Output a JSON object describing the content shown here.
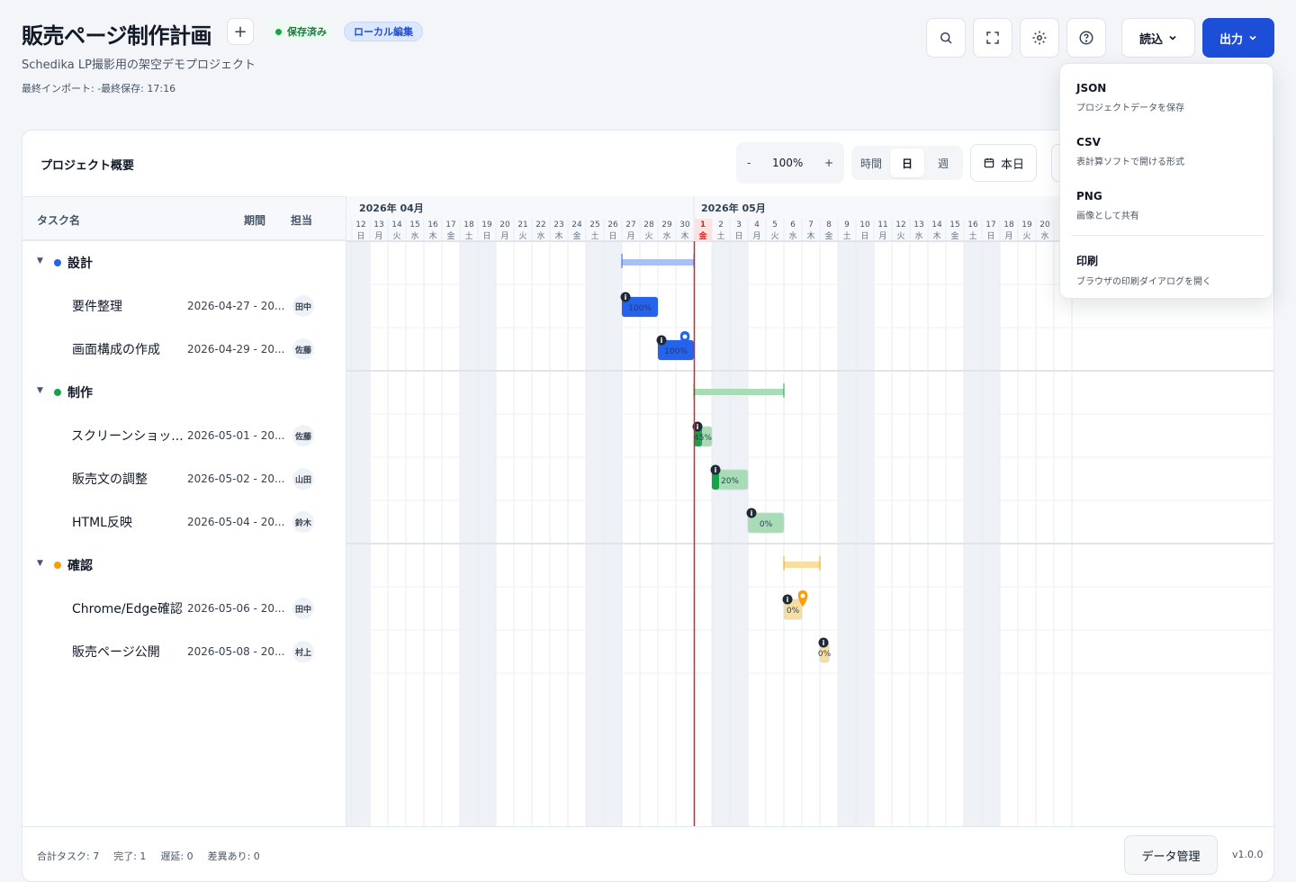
{
  "header": {
    "title": "販売ページ制作計画",
    "add_label": "+",
    "badge_saved": "保存済み",
    "badge_local": "ローカル編集",
    "subtitle": "Schedika LP撮影用の架空デモプロジェクト",
    "meta": "最終インポート: -最終保存: 17:16",
    "read_label": "読込",
    "export_label": "出力"
  },
  "toolbar": {
    "panel_title": "プロジェクト概要",
    "zoom_minus": "-",
    "zoom_value": "100%",
    "zoom_plus": "+",
    "scale_hour": "時間",
    "scale_day": "日",
    "scale_week": "週",
    "today_label": "本日"
  },
  "columns": {
    "task": "タスク名",
    "period": "期間",
    "owner": "担当"
  },
  "timeline": {
    "month_apr": "2026年 04月",
    "month_may": "2026年 05月",
    "days": [
      [
        "12",
        "日"
      ],
      [
        "13",
        "月"
      ],
      [
        "14",
        "火"
      ],
      [
        "15",
        "水"
      ],
      [
        "16",
        "木"
      ],
      [
        "17",
        "金"
      ],
      [
        "18",
        "土"
      ],
      [
        "19",
        "日"
      ],
      [
        "20",
        "月"
      ],
      [
        "21",
        "火"
      ],
      [
        "22",
        "水"
      ],
      [
        "23",
        "木"
      ],
      [
        "24",
        "金"
      ],
      [
        "25",
        "土"
      ],
      [
        "26",
        "日"
      ],
      [
        "27",
        "月"
      ],
      [
        "28",
        "火"
      ],
      [
        "29",
        "水"
      ],
      [
        "30",
        "木"
      ],
      [
        "1",
        "金"
      ],
      [
        "2",
        "土"
      ],
      [
        "3",
        "日"
      ],
      [
        "4",
        "月"
      ],
      [
        "5",
        "火"
      ],
      [
        "6",
        "水"
      ],
      [
        "7",
        "木"
      ],
      [
        "8",
        "金"
      ],
      [
        "9",
        "土"
      ],
      [
        "10",
        "日"
      ],
      [
        "11",
        "月"
      ],
      [
        "12",
        "火"
      ],
      [
        "13",
        "水"
      ],
      [
        "14",
        "木"
      ],
      [
        "15",
        "金"
      ],
      [
        "16",
        "土"
      ],
      [
        "17",
        "日"
      ],
      [
        "18",
        "月"
      ],
      [
        "19",
        "火"
      ],
      [
        "20",
        "水"
      ]
    ],
    "today_index": 19
  },
  "groups": [
    {
      "name": "設計",
      "color": "#2563eb",
      "bar_color": "#a9c0f3",
      "tasks": [
        {
          "name": "要件整理",
          "dates": "2026-04-27 - 20...",
          "owner": "田中",
          "progress": "100%"
        },
        {
          "name": "画面構成の作成",
          "dates": "2026-04-29 - 20...",
          "owner": "佐藤",
          "progress": "100%"
        }
      ]
    },
    {
      "name": "制作",
      "color": "#16a34a",
      "bar_color": "#a7dcb5",
      "tasks": [
        {
          "name": "スクリーンショッ...",
          "dates": "2026-05-01 - 20...",
          "owner": "佐藤",
          "progress": "45%"
        },
        {
          "name": "販売文の調整",
          "dates": "2026-05-02 - 20...",
          "owner": "山田",
          "progress": "20%"
        },
        {
          "name": "HTML反映",
          "dates": "2026-05-04 - 20...",
          "owner": "鈴木",
          "progress": "0%"
        }
      ]
    },
    {
      "name": "確認",
      "color": "#f59e0b",
      "bar_color": "#f8dfa0",
      "tasks": [
        {
          "name": "Chrome/Edge確認",
          "dates": "2026-05-06 - 20...",
          "owner": "田中",
          "progress": "0%"
        },
        {
          "name": "販売ページ公開",
          "dates": "2026-05-08 - 20...",
          "owner": "村上",
          "progress": "0%"
        }
      ]
    }
  ],
  "footer": {
    "total": "合計タスク: 7",
    "done": "完了: 1",
    "late": "遅延: 0",
    "diff": "差異あり: 0",
    "data_button": "データ管理",
    "version": "v1.0.0"
  },
  "dropdown": {
    "items": [
      {
        "title": "JSON",
        "desc": "プロジェクトデータを保存"
      },
      {
        "title": "CSV",
        "desc": "表計算ソフトで開ける形式"
      },
      {
        "title": "PNG",
        "desc": "画像として共有"
      },
      {
        "title": "印刷",
        "desc": "ブラウザの印刷ダイアログを開く"
      }
    ]
  },
  "colors": {
    "accent": "#1d4ed8",
    "today_line": "#dc2626"
  }
}
